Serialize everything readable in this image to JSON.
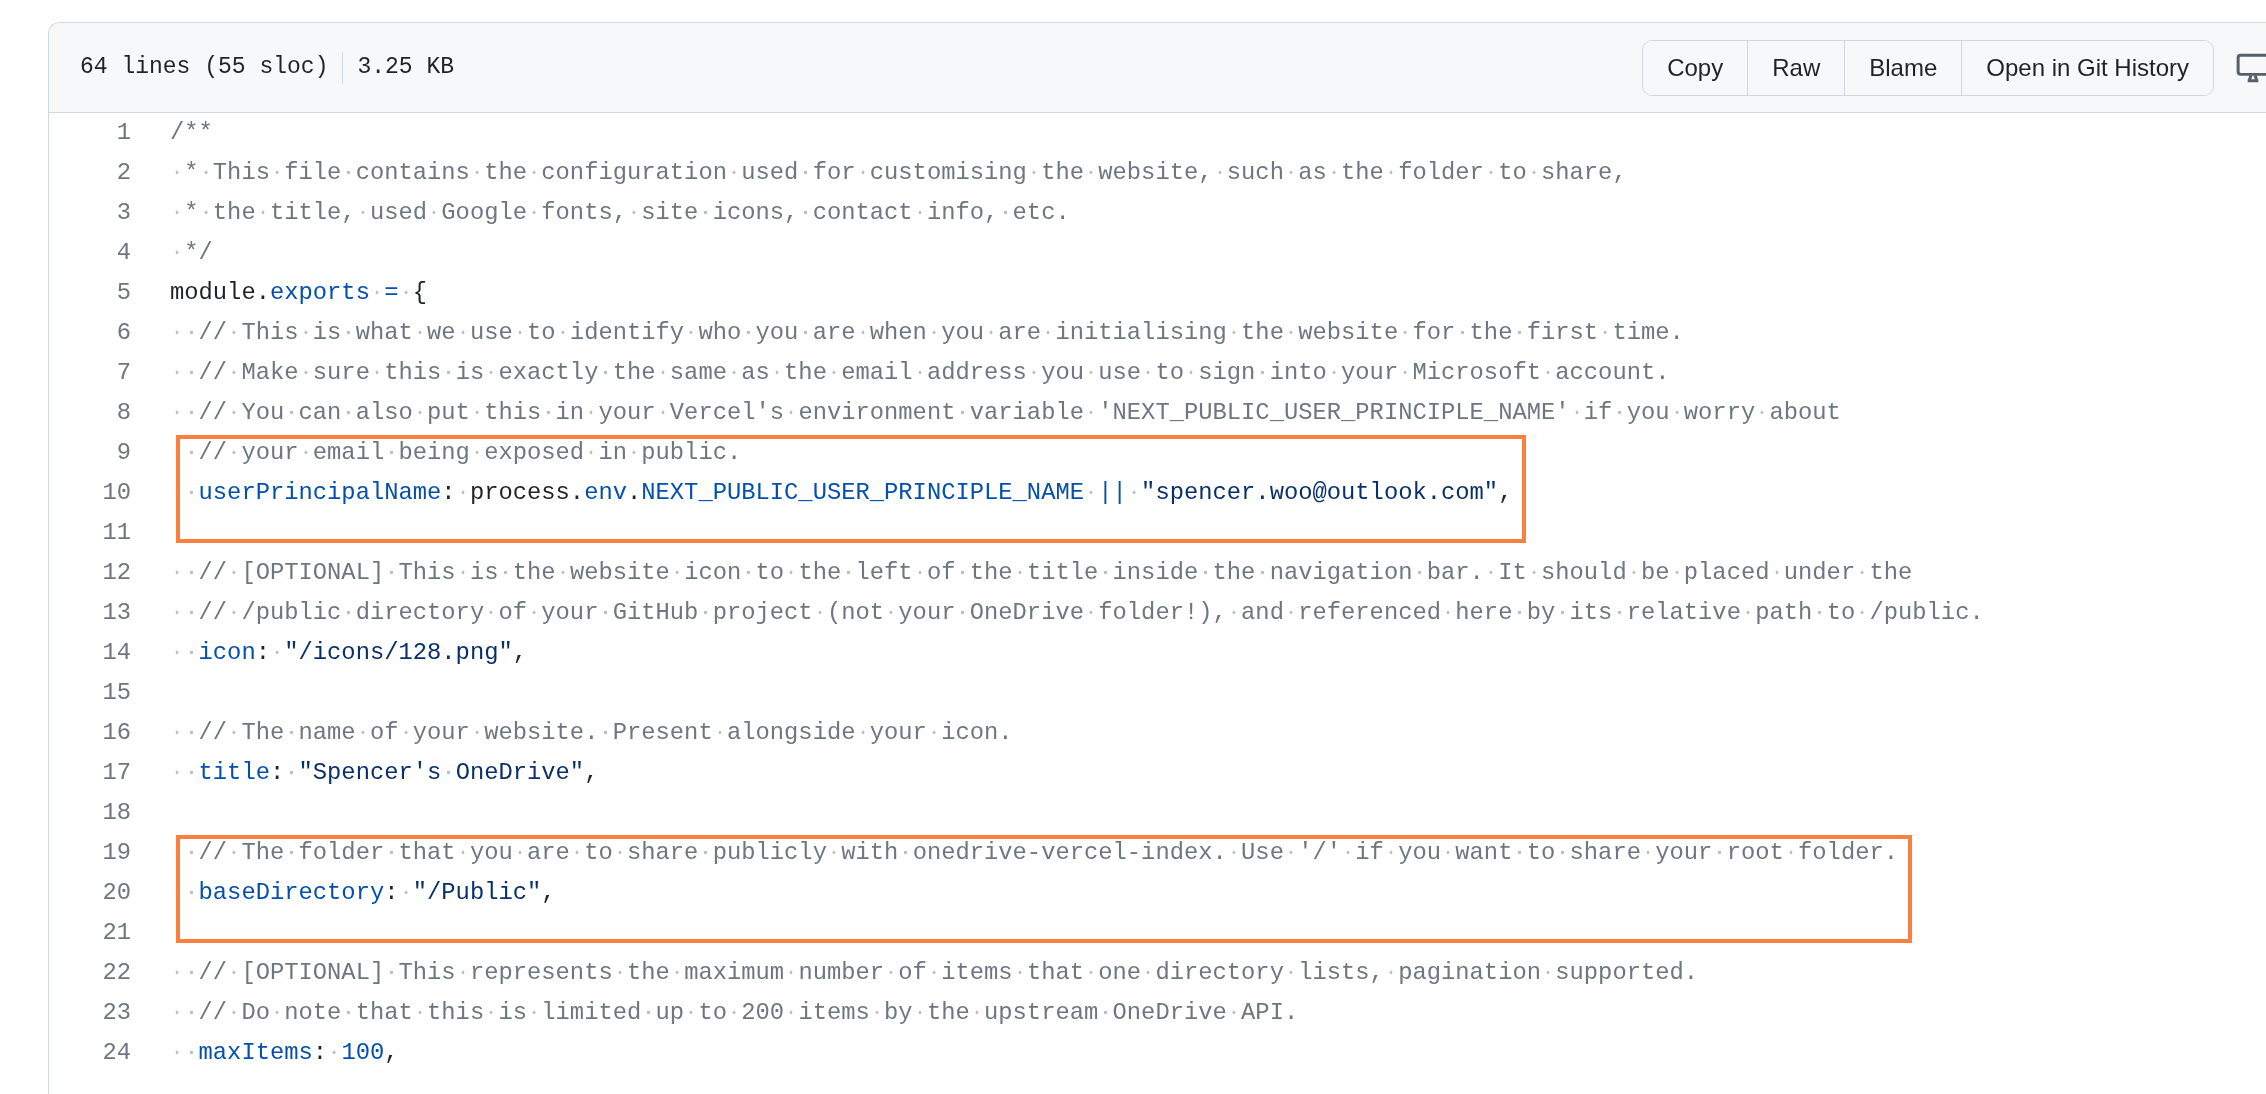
{
  "file_info": {
    "lines": "64 lines (55 sloc)",
    "size": "3.25 KB"
  },
  "buttons": [
    {
      "label": "Copy"
    },
    {
      "label": "Raw"
    },
    {
      "label": "Blame"
    },
    {
      "label": "Open in Git History"
    }
  ],
  "blocks": [
    {
      "highlighted": false,
      "lines": [
        {
          "number": "1",
          "tokens": [
            {
              "kind": "comment",
              "text": "/**"
            }
          ]
        },
        {
          "number": "2",
          "tokens": [
            {
              "kind": "comment",
              "text": " * This file contains the configuration used for customising the website, such as the folder to share,"
            }
          ]
        },
        {
          "number": "3",
          "tokens": [
            {
              "kind": "comment",
              "text": " * the title, used Google fonts, site icons, contact info, etc."
            }
          ]
        },
        {
          "number": "4",
          "tokens": [
            {
              "kind": "comment",
              "text": " */"
            }
          ]
        },
        {
          "number": "5",
          "tokens": [
            {
              "kind": "plain",
              "text": "module."
            },
            {
              "kind": "key",
              "text": "exports"
            },
            {
              "kind": "key",
              "text": " = "
            },
            {
              "kind": "plain",
              "text": "{"
            }
          ]
        },
        {
          "number": "6",
          "tokens": [
            {
              "kind": "comment",
              "text": "  // This is what we use to identify who you are when you are initialising the website for the first time."
            }
          ]
        },
        {
          "number": "7",
          "tokens": [
            {
              "kind": "comment",
              "text": "  // Make sure this is exactly the same as the email address you use to sign into your Microsoft account."
            }
          ]
        },
        {
          "number": "8",
          "tokens": [
            {
              "kind": "comment",
              "text": "  // You can also put this in your Vercel's environment variable 'NEXT_PUBLIC_USER_PRINCIPLE_NAME' if you worry about"
            }
          ]
        }
      ]
    },
    {
      "highlighted": true,
      "lines": [
        {
          "number": "9",
          "tokens": [
            {
              "kind": "comment",
              "text": "  // your email being exposed in public."
            }
          ]
        },
        {
          "number": "10",
          "tokens": [
            {
              "kind": "key",
              "text": "  userPrincipalName"
            },
            {
              "kind": "plain",
              "text": ": process."
            },
            {
              "kind": "key",
              "text": "env"
            },
            {
              "kind": "plain",
              "text": "."
            },
            {
              "kind": "key",
              "text": "NEXT_PUBLIC_USER_PRINCIPLE_NAME"
            },
            {
              "kind": "key",
              "text": " || "
            },
            {
              "kind": "string",
              "text": "\"spencer.woo@outlook.com\""
            },
            {
              "kind": "plain",
              "text": ","
            }
          ]
        },
        {
          "number": "11"
        }
      ]
    },
    {
      "highlighted": false,
      "lines": [
        {
          "number": "12",
          "tokens": [
            {
              "kind": "comment",
              "text": "  // [OPTIONAL] This is the website icon to the left of the title inside the navigation bar. It should be placed under the"
            }
          ]
        },
        {
          "number": "13",
          "tokens": [
            {
              "kind": "comment",
              "text": "  // /public directory of your GitHub project (not your OneDrive folder!), and referenced here by its relative path to /public."
            }
          ]
        },
        {
          "number": "14",
          "tokens": [
            {
              "kind": "key",
              "text": "  icon"
            },
            {
              "kind": "plain",
              "text": ": "
            },
            {
              "kind": "string",
              "text": "\"/icons/128.png\""
            },
            {
              "kind": "plain",
              "text": ","
            }
          ]
        },
        {
          "number": "15"
        },
        {
          "number": "16",
          "tokens": [
            {
              "kind": "comment",
              "text": "  // The name of your website. Present alongside your icon."
            }
          ]
        },
        {
          "number": "17",
          "tokens": [
            {
              "kind": "key",
              "text": "  title"
            },
            {
              "kind": "plain",
              "text": ": "
            },
            {
              "kind": "string",
              "text": "\"Spencer's OneDrive\""
            },
            {
              "kind": "plain",
              "text": ","
            }
          ]
        },
        {
          "number": "18"
        }
      ]
    },
    {
      "highlighted": true,
      "lines": [
        {
          "number": "19",
          "tokens": [
            {
              "kind": "comment",
              "text": "  // The folder that you are to share publicly with onedrive-vercel-index. Use '/' if you want to share your root folder."
            }
          ]
        },
        {
          "number": "20",
          "tokens": [
            {
              "kind": "key",
              "text": "  baseDirectory"
            },
            {
              "kind": "plain",
              "text": ": "
            },
            {
              "kind": "string",
              "text": "\"/Public\""
            },
            {
              "kind": "plain",
              "text": ","
            }
          ]
        },
        {
          "number": "21"
        }
      ]
    },
    {
      "highlighted": false,
      "lines": [
        {
          "number": "22",
          "tokens": [
            {
              "kind": "comment",
              "text": "  // [OPTIONAL] This represents the maximum number of items that one directory lists, pagination supported."
            }
          ]
        },
        {
          "number": "23",
          "tokens": [
            {
              "kind": "comment",
              "text": "  // Do note that this is limited up to 200 items by the upstream OneDrive API."
            }
          ]
        },
        {
          "number": "24",
          "tokens": [
            {
              "kind": "key",
              "text": "  maxItems"
            },
            {
              "kind": "plain",
              "text": ": "
            },
            {
              "kind": "number",
              "text": "100"
            },
            {
              "kind": "plain",
              "text": ","
            }
          ]
        }
      ]
    }
  ]
}
